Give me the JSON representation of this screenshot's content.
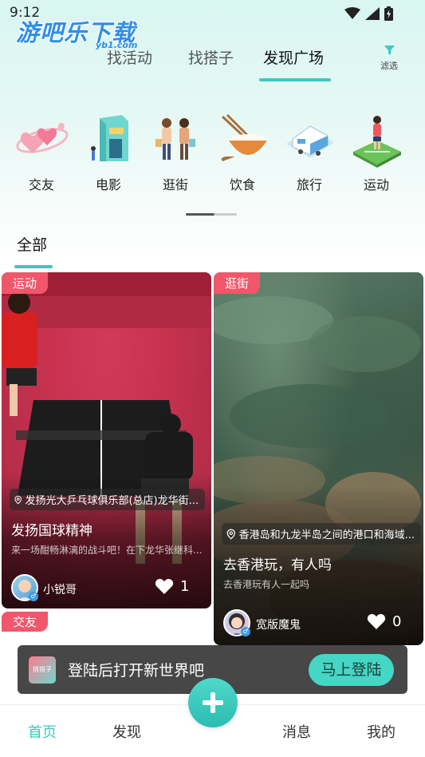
{
  "status_bar": {
    "time": "9:12"
  },
  "watermark": {
    "text": "游吧乐下载",
    "sub": "yb1.com"
  },
  "top_tabs": [
    {
      "label": "找活动",
      "active": false
    },
    {
      "label": "找搭子",
      "active": false
    },
    {
      "label": "发现广场",
      "active": true
    }
  ],
  "filter": {
    "label": "滤选",
    "icon": "funnel-icon"
  },
  "categories": [
    {
      "label": "交友",
      "icon": "hearts-icon"
    },
    {
      "label": "电影",
      "icon": "cinema-icon"
    },
    {
      "label": "逛街",
      "icon": "shopping-icon"
    },
    {
      "label": "饮食",
      "icon": "food-bowl-icon"
    },
    {
      "label": "旅行",
      "icon": "travel-camper-icon"
    },
    {
      "label": "运动",
      "icon": "sports-icon"
    }
  ],
  "section": {
    "label": "全部"
  },
  "cards": [
    {
      "tag": "运动",
      "location": "发扬光大乒乓球俱乐部(总店)龙华街...",
      "title": "发扬国球精神",
      "desc": "来一场酣畅淋漓的战斗吧！在下龙华张继科...",
      "user": "小锐哥",
      "likes": "1"
    },
    {
      "tag": "逛街",
      "location": "香港岛和九龙半岛之间的港口和海域...",
      "title": "去香港玩，有人吗",
      "desc": "去香港玩有人一起吗",
      "user": "宽版魔鬼",
      "likes": "0"
    }
  ],
  "next_card_tag": "交友",
  "login_banner": {
    "text": "登陆后打开新世界吧",
    "button": "马上登陆",
    "logo_text": "搭搭子"
  },
  "bottom_nav": [
    {
      "label": "首页",
      "active": true
    },
    {
      "label": "发现",
      "active": false
    },
    {
      "label": "消息",
      "active": false
    },
    {
      "label": "我的",
      "active": false
    }
  ],
  "colors": {
    "accent": "#3cc9bf",
    "tag": "#f0576a"
  }
}
